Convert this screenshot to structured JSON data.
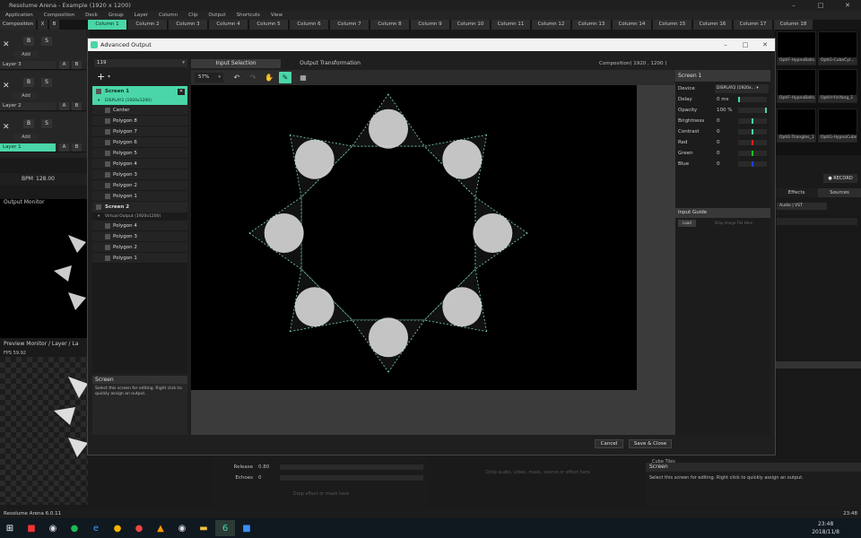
{
  "app": {
    "title": "Resolume Arena - Example (1920 x 1200)",
    "menu": [
      "Application",
      "Composition",
      "Deck",
      "Group",
      "Layer",
      "Column",
      "Clip",
      "Output",
      "Shortcuts",
      "View"
    ]
  },
  "columns": {
    "composition_label": "Composition",
    "small_buttons": [
      "X",
      "B"
    ],
    "items": [
      "Column 1",
      "Column 2",
      "Column 3",
      "Column 4",
      "Column 5",
      "Column 6",
      "Column 7",
      "Column 8",
      "Column 9",
      "Column 10",
      "Column 11",
      "Column 12",
      "Column 13",
      "Column 14",
      "Column 15",
      "Column 16",
      "Column 17",
      "Column 18"
    ],
    "active_index": 0
  },
  "layers": [
    {
      "name": "Layer 3",
      "b": "B",
      "s": "S",
      "add": "Add",
      "a": "A",
      "b2": "B",
      "selected": false
    },
    {
      "name": "Layer 2",
      "b": "B",
      "s": "S",
      "add": "Add",
      "a": "A",
      "b2": "B",
      "selected": false
    },
    {
      "name": "Layer 1",
      "b": "B",
      "s": "S",
      "add": "Add",
      "a": "A",
      "b2": "B",
      "selected": true
    }
  ],
  "bpm": {
    "label": "BPM",
    "value": "128.00"
  },
  "monitors": {
    "output": "Output Monitor",
    "preview": "Preview Monitor / Layer / La",
    "fps": "FPS 59.92"
  },
  "envelope": {
    "release_label": "Release",
    "release_value": "0.80",
    "echoes_label": "Echoes",
    "echoes_value": "0",
    "drop_hint": "Drop effect or mask here",
    "drop_hint_2": "Drop audio, video, mask, source or effect here"
  },
  "right_panel": {
    "thumbs": [
      "OptiF-HypnoBalls...",
      "OptiG-CubeCyl...",
      "OptiF-HypnoBalls...",
      "OptiH-YinYang_1",
      "OptiE-Triangles_1",
      "OptiG-HypnoCube..."
    ],
    "record": "RECORD",
    "tabs": [
      "Effects",
      "Sources"
    ],
    "active_tab": 1,
    "audio_vst": "Audio | VST",
    "cube_tiles": "Cube Tiles",
    "info_title": "Screen",
    "info_text": "Select this screen for editing. Right click to quickly assign an output."
  },
  "status": {
    "left": "Resolume Arena 6.0.11",
    "right": "23:48"
  },
  "taskbar": {
    "time": "23:48",
    "date": "2018/11/8"
  },
  "dialog": {
    "title": "Advanced Output",
    "preset": "119",
    "tabs": [
      "Input Selection",
      "Output Transformation"
    ],
    "active_tab": 0,
    "composition": "Composition( 1920 , 1200 )",
    "zoom": "57%",
    "tree": [
      {
        "type": "screen",
        "label": "Screen 1",
        "selected": true
      },
      {
        "type": "sub",
        "label": "DISPLAY2 (1920x1200)",
        "selected": true
      },
      {
        "type": "poly",
        "label": "Center"
      },
      {
        "type": "poly",
        "label": "Polygon 8"
      },
      {
        "type": "poly",
        "label": "Polygon 7"
      },
      {
        "type": "poly",
        "label": "Polygon 6"
      },
      {
        "type": "poly",
        "label": "Polygon 5"
      },
      {
        "type": "poly",
        "label": "Polygon 4"
      },
      {
        "type": "poly",
        "label": "Polygon 3"
      },
      {
        "type": "poly",
        "label": "Polygon 2"
      },
      {
        "type": "poly",
        "label": "Polygon 1"
      },
      {
        "type": "screen",
        "label": "Screen 2",
        "selected": false
      },
      {
        "type": "sub",
        "label": "Virtual Output (1920x1200)",
        "selected": false
      },
      {
        "type": "poly",
        "label": "Polygon 4"
      },
      {
        "type": "poly",
        "label": "Polygon 3"
      },
      {
        "type": "poly",
        "label": "Polygon 2"
      },
      {
        "type": "poly",
        "label": "Polygon 1"
      }
    ],
    "help": {
      "title": "Screen",
      "text": "Select this screen for editing. Right click to quickly assign an output."
    },
    "props": {
      "title": "Screen 1",
      "device_label": "Device",
      "device_value": "DISPLAY2 (1920x...",
      "delay_label": "Delay",
      "delay_value": "0 ms",
      "opacity_label": "Opacity",
      "opacity_value": "100 %",
      "brightness_label": "Brightness",
      "brightness_value": "0",
      "contrast_label": "Contrast",
      "contrast_value": "0",
      "red_label": "Red",
      "red_value": "0",
      "green_label": "Green",
      "green_value": "0",
      "blue_label": "Blue",
      "blue_value": "0",
      "guide_title": "Input Guide",
      "load": "Load",
      "drop_image": "Drop Image File Here"
    },
    "cancel": "Cancel",
    "save": "Save & Close"
  },
  "colors": {
    "accent": "#4ad6a8",
    "red": "#e02020",
    "green": "#20c020",
    "blue": "#2040e0"
  }
}
